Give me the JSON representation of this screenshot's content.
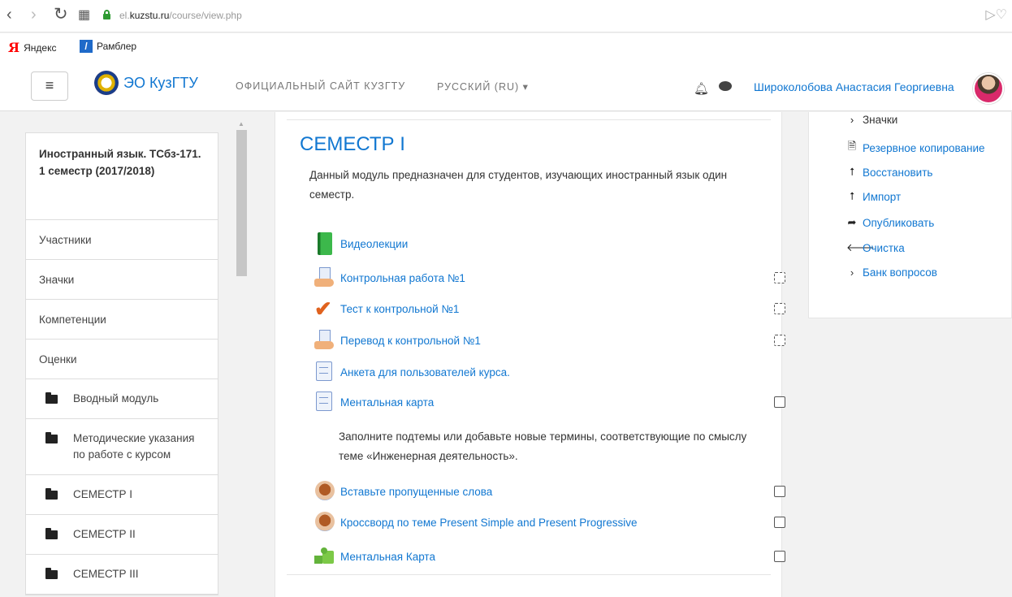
{
  "browser": {
    "url_domain": "el.kuzstu.ru",
    "url_path": "/course/view.php",
    "url_prefix": "el.",
    "url_host": "kuzstu.ru",
    "bookmarks": [
      {
        "label": "Яндекс",
        "icon": "yandex-icon"
      },
      {
        "label": "Рамблер",
        "icon": "rambler-icon"
      }
    ]
  },
  "navbar": {
    "brand": "ЭО КузГТУ",
    "site_link": "ОФИЦИАЛЬНЫЙ САЙТ КУЗГТУ",
    "language": "РУССКИЙ (RU) ▾",
    "user_name": "Широколобова Анастасия Георгиевна"
  },
  "drawer": {
    "course_title": "Иностранный язык. ТСбз-171. 1 семестр (2017/2018)",
    "items": [
      "Участники",
      "Значки",
      "Компетенции",
      "Оценки"
    ],
    "sections": [
      "Вводный модуль",
      "Методические указания по работе с курсом",
      "СЕМЕСТР I",
      "СЕМЕСТР II",
      "СЕМЕСТР III"
    ]
  },
  "main": {
    "section_title": "СЕМЕСТР I",
    "summary": "Данный модуль предназначен для студентов, изучающих иностранный язык один семестр.",
    "activities": [
      {
        "label": "Видеолекции",
        "icon": "book-icon",
        "completion": "none"
      },
      {
        "label": "Контрольная работа №1",
        "icon": "assignment-icon",
        "completion": "manual-dashed"
      },
      {
        "label": "Тест к контрольной №1",
        "icon": "quiz-icon",
        "completion": "manual-dashed"
      },
      {
        "label": "Перевод к контрольной №1",
        "icon": "assignment-icon",
        "completion": "manual-dashed"
      },
      {
        "label": "Анкета для пользователей курса.",
        "icon": "page-icon",
        "completion": "none"
      },
      {
        "label": "Ментальная карта",
        "icon": "page-icon",
        "completion": "manual"
      },
      {
        "label": "Вставьте пропущенные слова",
        "icon": "hotpot-icon",
        "completion": "manual"
      },
      {
        "label": "Кроссворд по теме Present Simple and Present Progressive",
        "icon": "hotpot-icon",
        "completion": "manual"
      },
      {
        "label": "Ментальная Карта",
        "icon": "puzzle-icon",
        "completion": "manual"
      }
    ],
    "note": "Заполните подтемы или добавьте новые термины, соответствующие по смыслу теме «Инженерная деятельность»."
  },
  "admin_block": {
    "items": [
      {
        "label": "Значки",
        "icon": "chevron-right-icon",
        "kind": "plain"
      },
      {
        "label": "Резервное копирование",
        "icon": "backup-icon",
        "kind": "link"
      },
      {
        "label": "Восстановить",
        "icon": "restore-icon",
        "kind": "link"
      },
      {
        "label": "Импорт",
        "icon": "import-icon",
        "kind": "link"
      },
      {
        "label": "Опубликовать",
        "icon": "share-icon",
        "kind": "link"
      },
      {
        "label": "Очистка",
        "icon": "arrow-left-icon",
        "kind": "link"
      },
      {
        "label": "Банк вопросов",
        "icon": "chevron-right-icon",
        "kind": "link"
      }
    ]
  },
  "colors": {
    "link": "#1177d1",
    "text": "#333333",
    "background": "#f2f2f2"
  }
}
